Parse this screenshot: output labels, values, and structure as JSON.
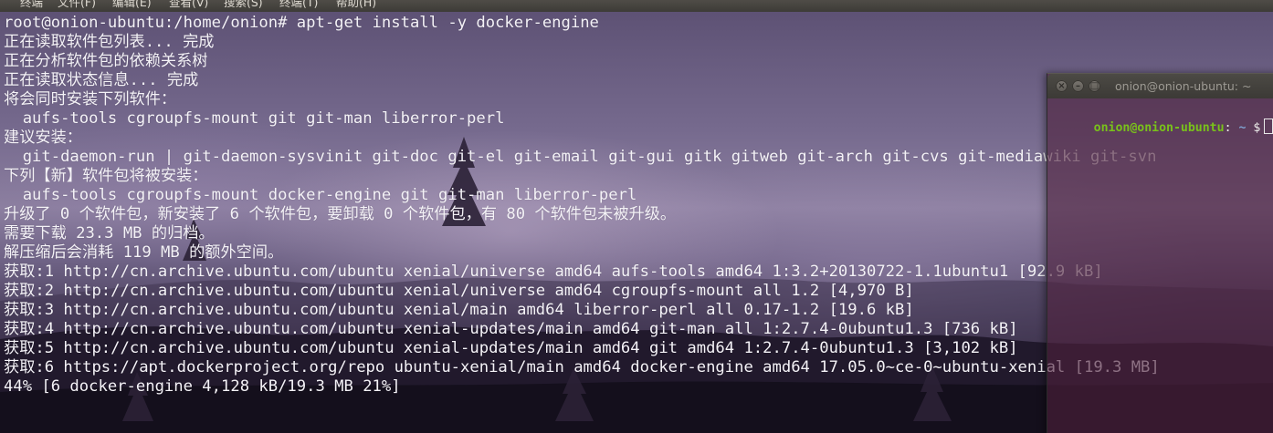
{
  "menubar": {
    "items": [
      {
        "label": "终端"
      },
      {
        "label": "文件(F)"
      },
      {
        "label": "编辑(E)"
      },
      {
        "label": "查看(V)"
      },
      {
        "label": "搜索(S)"
      },
      {
        "label": "终端(T)"
      },
      {
        "label": "帮助(H)"
      }
    ]
  },
  "terminal": {
    "lines": [
      "root@onion-ubuntu:/home/onion# apt-get install -y docker-engine",
      "正在读取软件包列表... 完成",
      "正在分析软件包的依赖关系树",
      "正在读取状态信息... 完成",
      "将会同时安装下列软件：",
      "  aufs-tools cgroupfs-mount git git-man liberror-perl",
      "建议安装：",
      "  git-daemon-run | git-daemon-sysvinit git-doc git-el git-email git-gui gitk gitweb git-arch git-cvs git-mediawiki git-svn",
      "下列【新】软件包将被安装：",
      "  aufs-tools cgroupfs-mount docker-engine git git-man liberror-perl",
      "升级了 0 个软件包，新安装了 6 个软件包，要卸载 0 个软件包，有 80 个软件包未被升级。",
      "需要下载 23.3 MB 的归档。",
      "解压缩后会消耗 119 MB 的额外空间。",
      "获取:1 http://cn.archive.ubuntu.com/ubuntu xenial/universe amd64 aufs-tools amd64 1:3.2+20130722-1.1ubuntu1 [92.9 kB]",
      "获取:2 http://cn.archive.ubuntu.com/ubuntu xenial/universe amd64 cgroupfs-mount all 1.2 [4,970 B]",
      "获取:3 http://cn.archive.ubuntu.com/ubuntu xenial/main amd64 liberror-perl all 0.17-1.2 [19.6 kB]",
      "获取:4 http://cn.archive.ubuntu.com/ubuntu xenial-updates/main amd64 git-man all 1:2.7.4-0ubuntu1.3 [736 kB]",
      "获取:5 http://cn.archive.ubuntu.com/ubuntu xenial-updates/main amd64 git amd64 1:2.7.4-0ubuntu1.3 [3,102 kB]",
      "获取:6 https://apt.dockerproject.org/repo ubuntu-xenial/main amd64 docker-engine amd64 17.05.0~ce-0~ubuntu-xenial [19.3 MB]",
      "44% [6 docker-engine 4,128 kB/19.3 MB 21%]"
    ]
  },
  "second_window": {
    "title": "onion@onion-ubuntu: ~",
    "prompt_user": "onion@onion-ubuntu",
    "prompt_colon": ":",
    "prompt_path": " ~",
    "prompt_symbol": "$"
  }
}
